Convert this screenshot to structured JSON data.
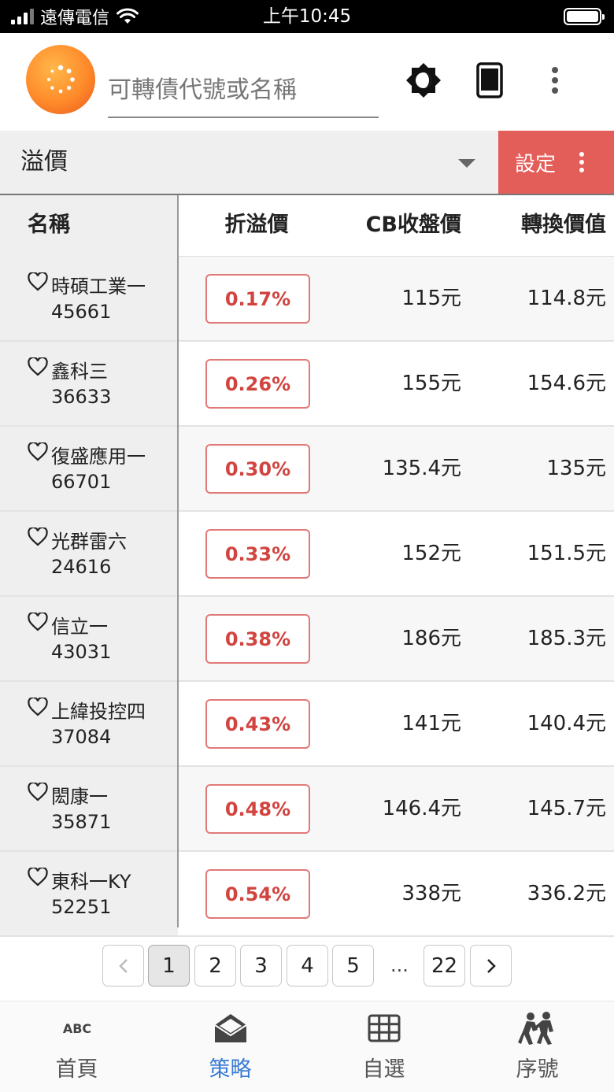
{
  "status_bar": {
    "carrier": "遠傳電信",
    "time": "上午10:45"
  },
  "header": {
    "search_placeholder": "可轉債代號或名稱",
    "icons": [
      "logo-icon",
      "brightness-icon",
      "phone-icon",
      "more-vert-icon"
    ]
  },
  "filter": {
    "selected": "溢價",
    "settings_label": "設定"
  },
  "table": {
    "columns": [
      "名稱",
      "折溢價",
      "CB收盤價",
      "轉換價值"
    ],
    "rows": [
      {
        "name": "時碩工業一",
        "code": "45661",
        "premium": "0.17%",
        "cb_price": "115元",
        "conv_value": "114.8元"
      },
      {
        "name": "鑫科三",
        "code": "36633",
        "premium": "0.26%",
        "cb_price": "155元",
        "conv_value": "154.6元"
      },
      {
        "name": "復盛應用一",
        "code": "66701",
        "premium": "0.30%",
        "cb_price": "135.4元",
        "conv_value": "135元"
      },
      {
        "name": "光群雷六",
        "code": "24616",
        "premium": "0.33%",
        "cb_price": "152元",
        "conv_value": "151.5元"
      },
      {
        "name": "信立一",
        "code": "43031",
        "premium": "0.38%",
        "cb_price": "186元",
        "conv_value": "185.3元"
      },
      {
        "name": "上緯投控四",
        "code": "37084",
        "premium": "0.43%",
        "cb_price": "141元",
        "conv_value": "140.4元"
      },
      {
        "name": "閎康一",
        "code": "35871",
        "premium": "0.48%",
        "cb_price": "146.4元",
        "conv_value": "145.7元"
      },
      {
        "name": "東科一KY",
        "code": "52251",
        "premium": "0.54%",
        "cb_price": "338元",
        "conv_value": "336.2元"
      }
    ]
  },
  "pagination": {
    "pages": [
      "1",
      "2",
      "3",
      "4",
      "5"
    ],
    "ellipsis": "...",
    "last": "22",
    "current": "1"
  },
  "bottom_nav": {
    "items": [
      {
        "label": "首頁",
        "icon": "abc-icon"
      },
      {
        "label": "策略",
        "icon": "mail-open-icon"
      },
      {
        "label": "自選",
        "icon": "grid-icon"
      },
      {
        "label": "序號",
        "icon": "people-icon"
      }
    ],
    "active": "策略"
  },
  "colors": {
    "accent_red": "#e35d59",
    "premium_text": "#d2443f",
    "active_blue": "#3a7bd5"
  }
}
